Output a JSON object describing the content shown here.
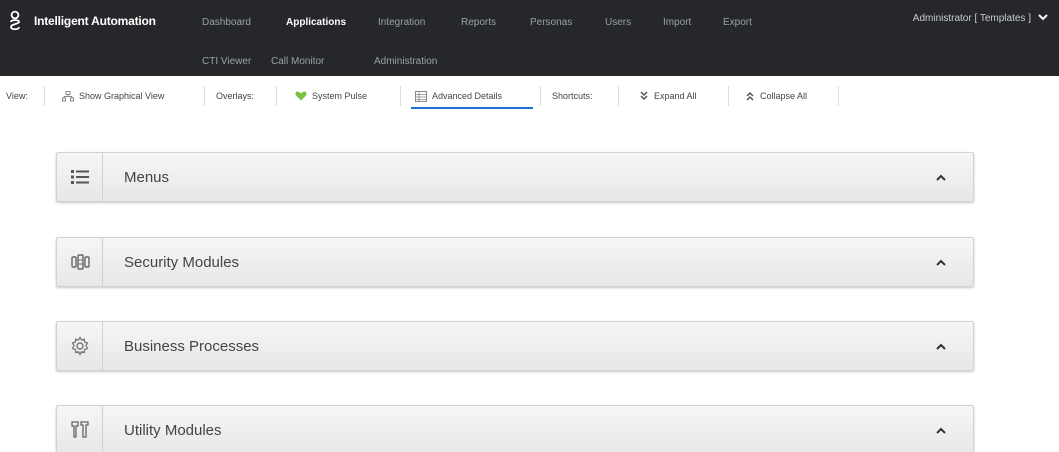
{
  "app": {
    "title": "Intelligent Automation",
    "logo_icon": "genesys-g-logo"
  },
  "nav": {
    "row1": [
      "Dashboard",
      "Applications",
      "Integration",
      "Reports",
      "Personas",
      "Users",
      "Import",
      "Export"
    ],
    "row2": [
      "CTI Viewer",
      "Call Monitor",
      "Administration"
    ],
    "active": "Applications"
  },
  "user": {
    "label": "Administrator [ Templates ]",
    "icon": "chevron-down-icon"
  },
  "toolbar": {
    "view_label": "View:",
    "graphical_view": "Show Graphical View",
    "overlays_label": "Overlays:",
    "system_pulse": "System Pulse",
    "advanced_details": "Advanced Details",
    "shortcuts_label": "Shortcuts:",
    "expand_all": "Expand All",
    "collapse_all": "Collapse All",
    "active_item": "Advanced Details"
  },
  "panels": [
    {
      "label": "Menus",
      "icon": "list-icon"
    },
    {
      "label": "Security Modules",
      "icon": "security-modules-icon"
    },
    {
      "label": "Business Processes",
      "icon": "gear-icon"
    },
    {
      "label": "Utility Modules",
      "icon": "utility-tools-icon"
    }
  ],
  "colors": {
    "nav_bg": "#26272b",
    "accent": "#1f6fd6",
    "pulse_green": "#7cc142"
  }
}
